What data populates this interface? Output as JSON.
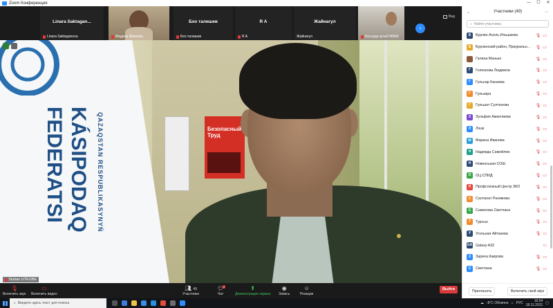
{
  "window": {
    "title": "Zoom Конференция"
  },
  "strip": {
    "tiles": [
      {
        "name": "Linara  Saktagan...",
        "caption": "Linara Saktaganova",
        "type": "name"
      },
      {
        "name": "",
        "caption": "Мадина Иванова",
        "type": "video"
      },
      {
        "name": "Бхо талишев",
        "caption": "Бхо талишев",
        "type": "name"
      },
      {
        "name": "R A",
        "caption": "R A",
        "type": "name"
      },
      {
        "name": "Жайнагул",
        "caption": "Жайнагул",
        "type": "name"
      },
      {
        "name": "",
        "caption": "Бессрда кучаб МБЕК",
        "type": "video"
      }
    ],
    "view_label": "Вид"
  },
  "main": {
    "speaker_caption": "Nurlan UTEUBE",
    "flag_lines": [
      "QAZAQSTAN RESPUBLIKASYNYŃ",
      "KÁSIPODAQ",
      "FEDERATSI"
    ],
    "poster_text": "Безопасный Труд"
  },
  "toolbar": {
    "mute": "Включить звук",
    "video": "Включить видео",
    "participants": "Участники",
    "participants_count": "49",
    "chat": "Чат",
    "chat_badge": "2",
    "share": "Демонстрация экрана",
    "record": "Запись",
    "reactions": "Реакции",
    "leave": "Выйти"
  },
  "panel": {
    "title": "Участники (49)",
    "search_placeholder": "Найти участника",
    "invite": "Пригласить",
    "unmute_me": "Включить свой звук",
    "participants": [
      {
        "initial": "Б",
        "name": "Бурлин Асель Ильшаева",
        "color": "#2e4a72",
        "muted": true,
        "video_off": true
      },
      {
        "initial": "Б",
        "name": "Бурлинский район, Приуральн...",
        "color": "#e7a92b",
        "muted": true,
        "video_off": true
      },
      {
        "initial": "",
        "name": "Галина Манько",
        "color": "#8a5a3a",
        "muted": true,
        "video_off": true
      },
      {
        "initial": "Г",
        "name": "Голенкова Людмила",
        "color": "#2e4a72",
        "muted": true,
        "video_off": true
      },
      {
        "initial": "Г",
        "name": "Гульнар Канаева",
        "color": "#2d8cff",
        "muted": true,
        "video_off": true
      },
      {
        "initial": "Г",
        "name": "Гульзара",
        "color": "#f28b2c",
        "muted": true,
        "video_off": true
      },
      {
        "initial": "Г",
        "name": "Гульшат Султанова",
        "color": "#e7a92b",
        "muted": true,
        "video_off": true
      },
      {
        "initial": "З",
        "name": "Зульфия Аманчиева",
        "color": "#7a4bd1",
        "muted": true,
        "video_off": true
      },
      {
        "initial": "Л",
        "name": "Ляззі",
        "color": "#2d8cff",
        "muted": true,
        "video_off": true
      },
      {
        "initial": "М",
        "name": "Марина Иванова",
        "color": "#2b9fd9",
        "muted": true,
        "video_off": true
      },
      {
        "initial": "Н",
        "name": "Надежда Самойлюк",
        "color": "#1f9e8a",
        "muted": true,
        "video_off": true
      },
      {
        "initial": "Н",
        "name": "Новенськая СОШ",
        "color": "#2e4a72",
        "muted": true,
        "video_off": true
      },
      {
        "initial": "О",
        "name": "ОЦ СПИД",
        "color": "#3aa54a",
        "muted": true,
        "video_off": true
      },
      {
        "initial": "П",
        "name": "Профсоюзный Центр ЗКО",
        "color": "#e5483d",
        "muted": true,
        "video_off": true
      },
      {
        "initial": "С",
        "name": "Салтанат Рахимова",
        "color": "#f28b2c",
        "muted": true,
        "video_off": true
      },
      {
        "initial": "С",
        "name": "Саменова Светлана",
        "color": "#3aa54a",
        "muted": true,
        "video_off": true
      },
      {
        "initial": "Т",
        "name": "Турсын",
        "color": "#f28b2c",
        "muted": true,
        "video_off": true
      },
      {
        "initial": "У",
        "name": "Угольная Айткаева",
        "color": "#2e4a72",
        "muted": true,
        "video_off": true
      },
      {
        "initial": "GA",
        "name": "Galaxy A32",
        "color": "#2e4a72",
        "muted": false,
        "video_off": true
      },
      {
        "initial": "З",
        "name": "Зарина Каирова",
        "color": "#2d8cff",
        "muted": true,
        "video_off": true
      },
      {
        "initial": "С",
        "name": "Светлана",
        "color": "#2d8cff",
        "muted": true,
        "video_off": true
      }
    ]
  },
  "taskbar": {
    "search_placeholder": "Введите здесь текст для поиска",
    "weather": "-8°C  Облачно",
    "lang": "РУС",
    "time": "16:54",
    "date": "18.11.2021"
  }
}
